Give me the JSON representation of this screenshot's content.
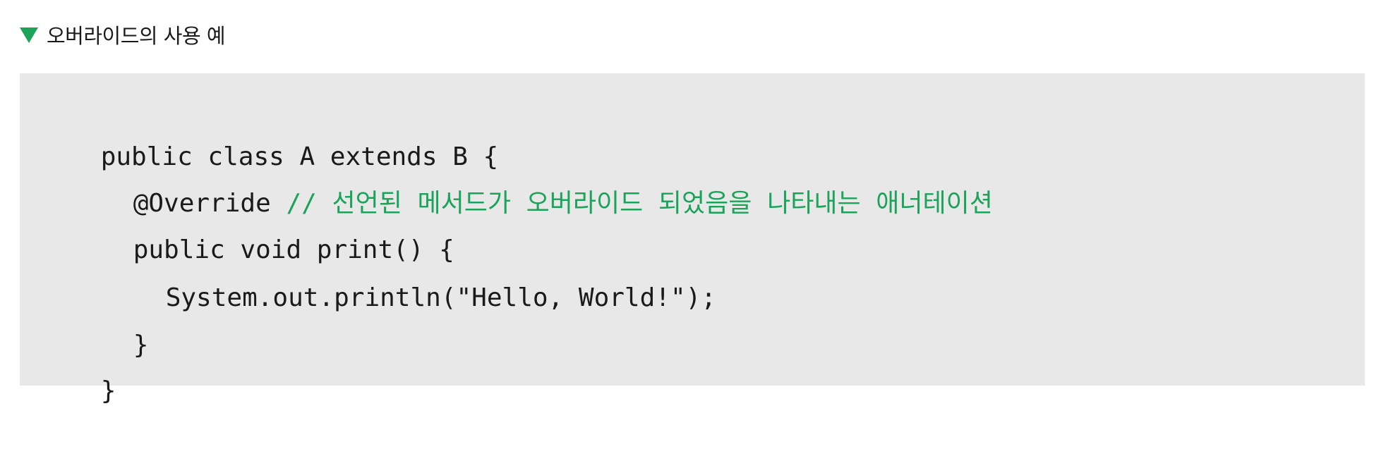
{
  "caption": {
    "icon": "triangle-down-icon",
    "text": "오버라이드의 사용 예"
  },
  "colors": {
    "accent_green": "#1ba35a",
    "code_background": "#e8e8e8",
    "code_text": "#1a1a1a"
  },
  "code": {
    "language": "Java",
    "lines": [
      {
        "code": "public class A extends B {",
        "comment": ""
      },
      {
        "code": "@Override ",
        "comment": "// 선언된 메서드가 오버라이드 되었음을 나타내는 애너테이션"
      },
      {
        "code": "public void print() {",
        "comment": ""
      },
      {
        "code": "System.out.println(\"Hello, World!\");",
        "comment": ""
      },
      {
        "code": "}",
        "comment": ""
      },
      {
        "code": "}",
        "comment": ""
      }
    ]
  }
}
